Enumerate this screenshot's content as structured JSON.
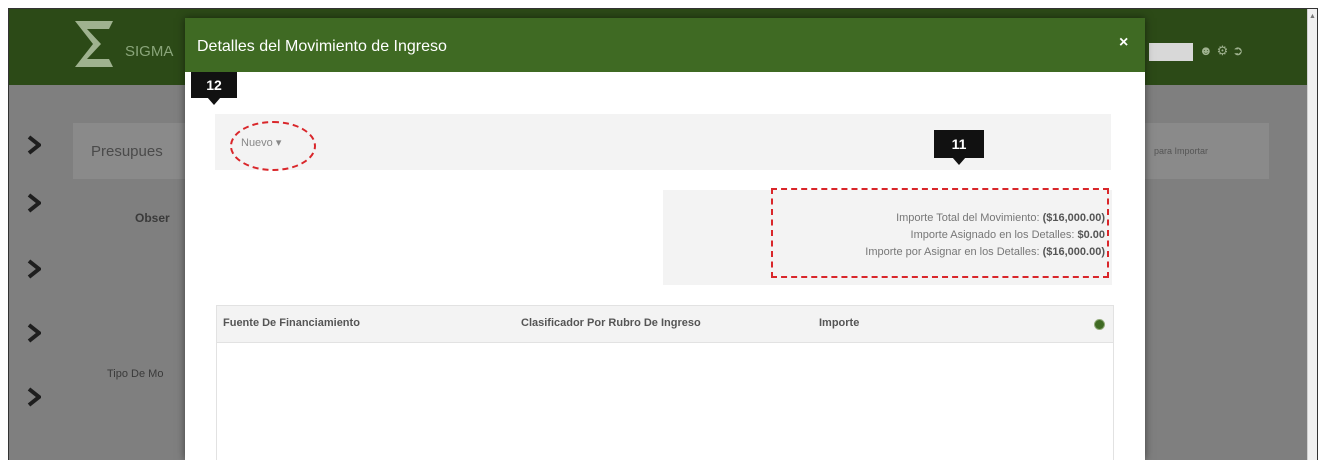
{
  "app": {
    "brand": "SIGMA"
  },
  "background": {
    "panel_label": "Presupues",
    "panel_right_text": "para Importar",
    "field_obs": "Obser",
    "field_tipo": "Tipo De Mo"
  },
  "modal": {
    "title": "Detalles del Movimiento de Ingreso",
    "close_label": "×",
    "new_button": "Nuevo ▾",
    "summary": {
      "total_label": "Importe Total del Movimiento:",
      "total_value": "($16,000.00)",
      "asignado_label": "Importe Asignado en los Detalles:",
      "asignado_value": "$0.00",
      "por_asignar_label": "Importe por Asignar en los Detalles:",
      "por_asignar_value": "($16,000.00)"
    },
    "table": {
      "columns": [
        "Fuente De Financiamiento",
        "Clasificador Por Rubro De Ingreso",
        "Importe"
      ],
      "rows": []
    }
  },
  "callouts": {
    "first": "12",
    "second": "11"
  },
  "colors": {
    "header_green": "#2c4a17",
    "modal_green": "#3f6a23",
    "highlight_red": "#d9262a"
  }
}
